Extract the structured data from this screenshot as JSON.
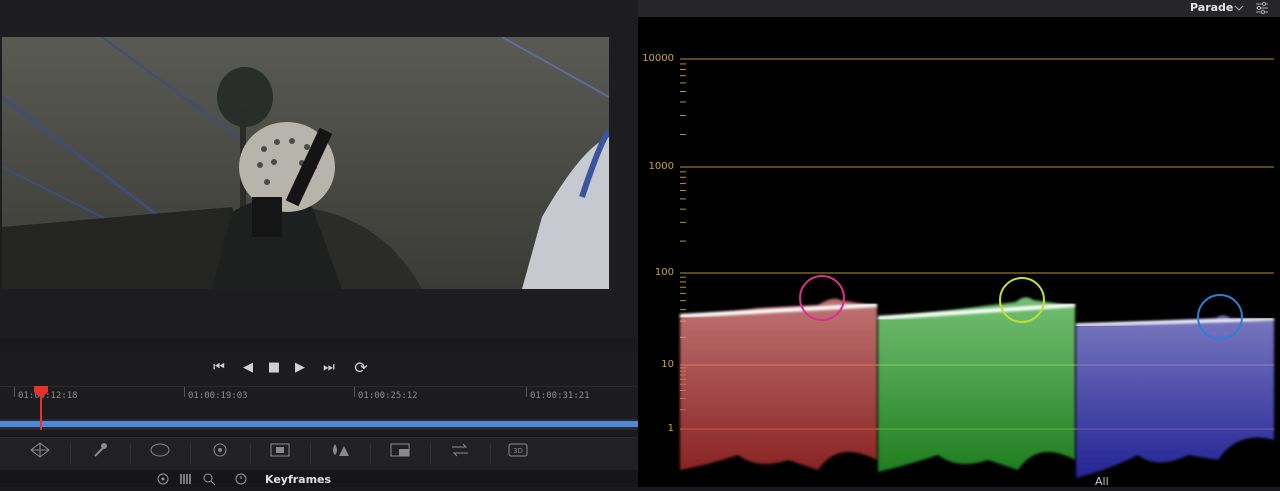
{
  "viewer": {
    "transport": {
      "first_icon": "⏮",
      "back_icon": "◀",
      "stop_icon": "■",
      "play_icon": "▶",
      "last_icon": "⏭",
      "loop_icon": "⟳"
    }
  },
  "timeline": {
    "timecodes": [
      "01:00:12:18",
      "01:00:19:03",
      "01:00:25:12",
      "01:00:31:21"
    ],
    "playhead_color": "#e8302d",
    "track_color": "#4a8ad8"
  },
  "toolbar": {
    "keyframes_label": "Keyframes",
    "all_label": "All"
  },
  "scope": {
    "mode_label": "Parade",
    "dropdown_icon": "chevron-down",
    "settings_icon": "sliders",
    "scale_labels": [
      "10000",
      "1000",
      "100",
      "10",
      "1"
    ],
    "line_color": "#b8942a",
    "circle_colors": [
      "#d8318a",
      "#c2e034",
      "#2c7fd4"
    ],
    "channel_colors": [
      "#ff6b6b",
      "#5cff5c",
      "#6a6aff"
    ]
  }
}
